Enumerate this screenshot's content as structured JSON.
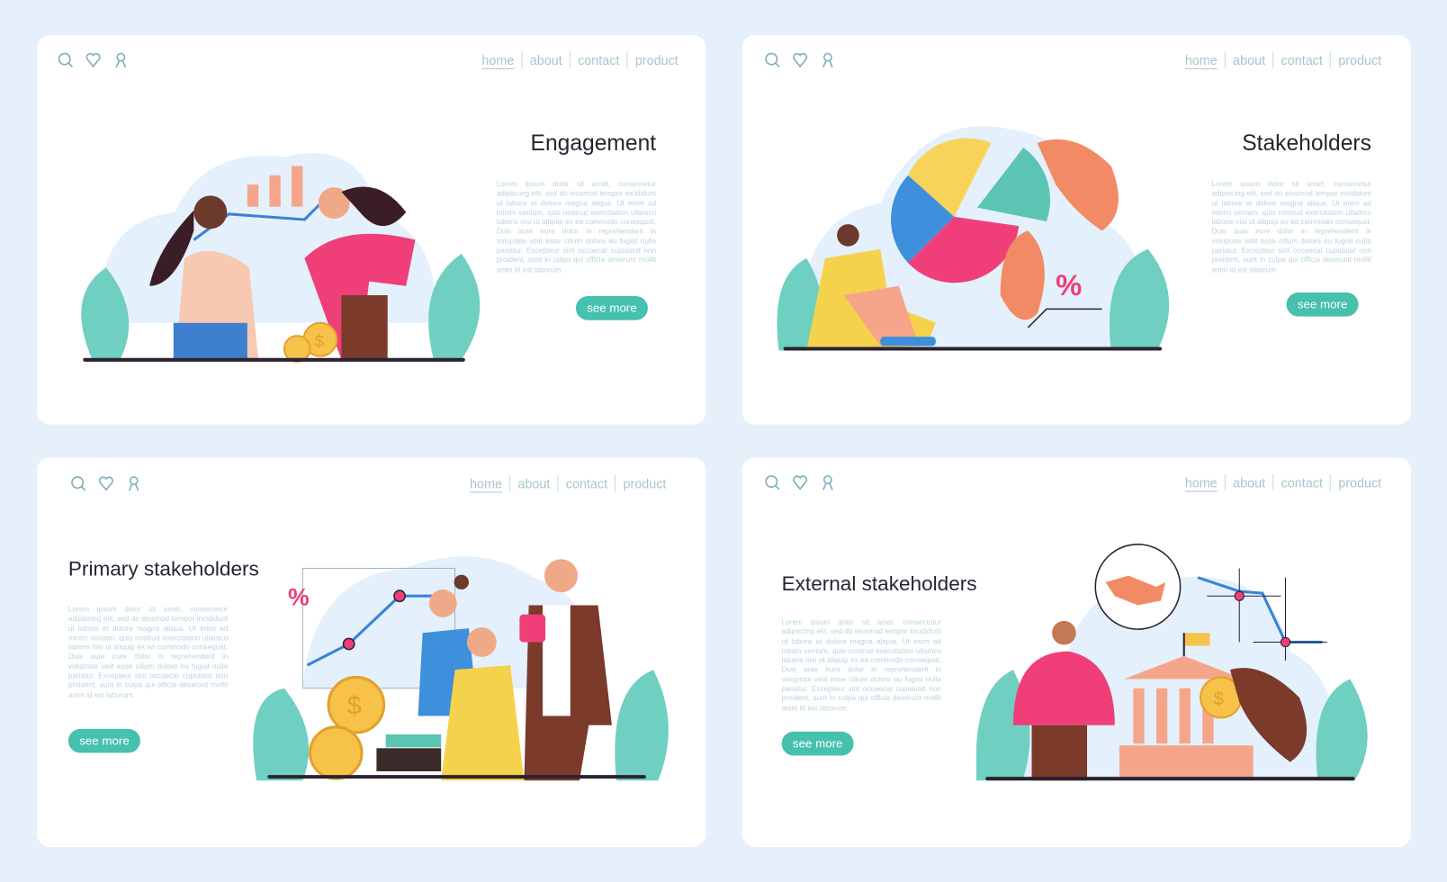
{
  "nav": {
    "home": "home",
    "about": "about",
    "contact": "contact",
    "product": "product"
  },
  "lorem": "Lorem ipsum dolor sit amet, consectetur adipiscing elit, sed do eiusmod tempor incididunt ut labore et dolore magna aliqua. Ut enim ad minim veniam, quis nostrud exercitation ullamco laboris nisi ut aliquip ex ea commodo consequat. Duis aute irure dolor in reprehenderit in voluptate velit esse cillum dolore eu fugiat nulla pariatur. Excepteur sint occaecat cupidatat non proident, sunt in culpa qui officia deserunt mollit anim id est laborum.",
  "panels": [
    {
      "title": "Engagement",
      "button": "see more"
    },
    {
      "title": "Stakeholders",
      "button": "see more"
    },
    {
      "title": "Primary stakeholders",
      "button": "see more"
    },
    {
      "title": "External stakeholders",
      "button": "see more"
    }
  ],
  "illustration_text": {
    "percent": "%",
    "dollar": "$"
  },
  "icons": [
    "search-icon",
    "heart-icon",
    "user-icon"
  ],
  "colors": {
    "background": "#e6f0fb",
    "accent": "#45c1ad",
    "nav_text": "#a9c4cc",
    "title": "#2a2230",
    "lorem": "#bcd4dc"
  }
}
